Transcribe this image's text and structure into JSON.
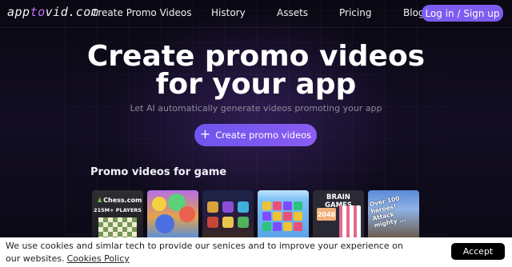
{
  "header": {
    "logo_prefix": "app",
    "logo_accent": "to",
    "logo_suffix": "vid.com",
    "nav": [
      {
        "label": "Create Promo Videos"
      },
      {
        "label": "History"
      },
      {
        "label": "Assets"
      },
      {
        "label": "Pricing"
      },
      {
        "label": "Blog"
      }
    ],
    "login_label": "Log in / Sign up"
  },
  "hero": {
    "title_line1": "Create promo videos",
    "title_line2": "for your app",
    "subtitle": "Let AI automatically generate videos promoting your app",
    "cta_label": "Create promo videos",
    "cta_icon": "plus-icon"
  },
  "section": {
    "title": "Promo videos for game",
    "thumbnails": [
      {
        "brand": "Chess.com",
        "caption": "215M+ PLAYERS"
      },
      {
        "caption": ""
      },
      {
        "caption": ""
      },
      {
        "caption": ""
      },
      {
        "caption": "BRAIN GAMES",
        "tile": "2048"
      },
      {
        "caption": "Over 100 heroes! Attack mighty ..."
      }
    ]
  },
  "cookie": {
    "text": "We use cookies and simlar tech to provide our senices and to improve your experience on our websites.",
    "link_label": "Cookies Policy",
    "accept_label": "Accept"
  },
  "colors": {
    "accent": "#7d5cf0",
    "logo_accent": "#c76dff",
    "background": "#07060c"
  }
}
